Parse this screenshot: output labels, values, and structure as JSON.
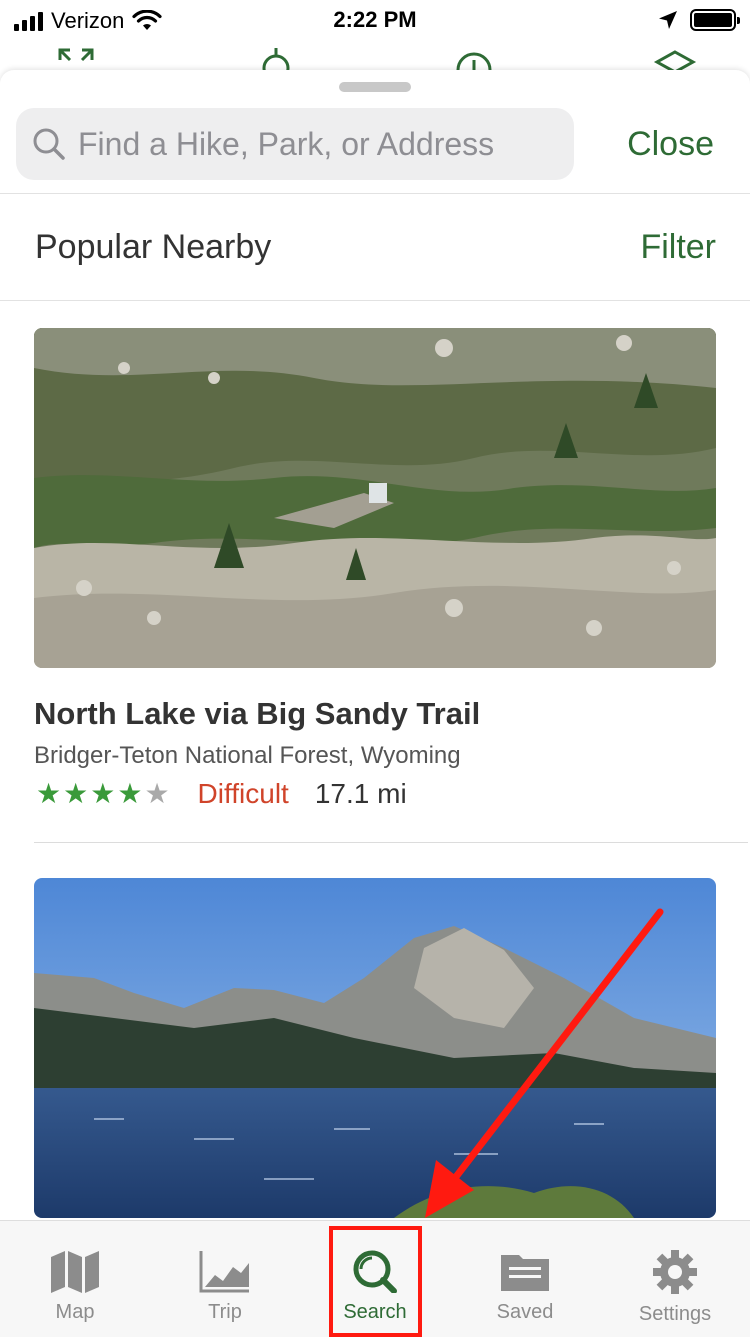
{
  "status_bar": {
    "carrier": "Verizon",
    "time": "2:22 PM",
    "icons": [
      "signal-icon",
      "wifi-icon",
      "location-arrow-icon",
      "battery-icon"
    ]
  },
  "search": {
    "placeholder": "Find a Hike, Park, or Address",
    "value": "",
    "close_label": "Close"
  },
  "section": {
    "title": "Popular Nearby",
    "filter_label": "Filter"
  },
  "trails": [
    {
      "name": "North Lake via Big Sandy Trail",
      "location": "Bridger-Teton National Forest, Wyoming",
      "rating": 4,
      "rating_max": 5,
      "difficulty": "Difficult",
      "distance": "17.1 mi",
      "photo": "rocky-slope-waterfall-photo"
    },
    {
      "photo": "mountain-lake-photo"
    }
  ],
  "tab_bar": {
    "tabs": [
      {
        "label": "Map",
        "icon": "map-icon",
        "active": false
      },
      {
        "label": "Trip",
        "icon": "trip-chart-icon",
        "active": false
      },
      {
        "label": "Search",
        "icon": "search-icon",
        "active": true
      },
      {
        "label": "Saved",
        "icon": "folder-icon",
        "active": false
      },
      {
        "label": "Settings",
        "icon": "gear-icon",
        "active": false
      }
    ]
  },
  "colors": {
    "brand_green": "#2e6b35",
    "star_green": "#3a9a3a",
    "difficulty_red": "#d0442a",
    "annotation_red": "#ff1a10"
  }
}
